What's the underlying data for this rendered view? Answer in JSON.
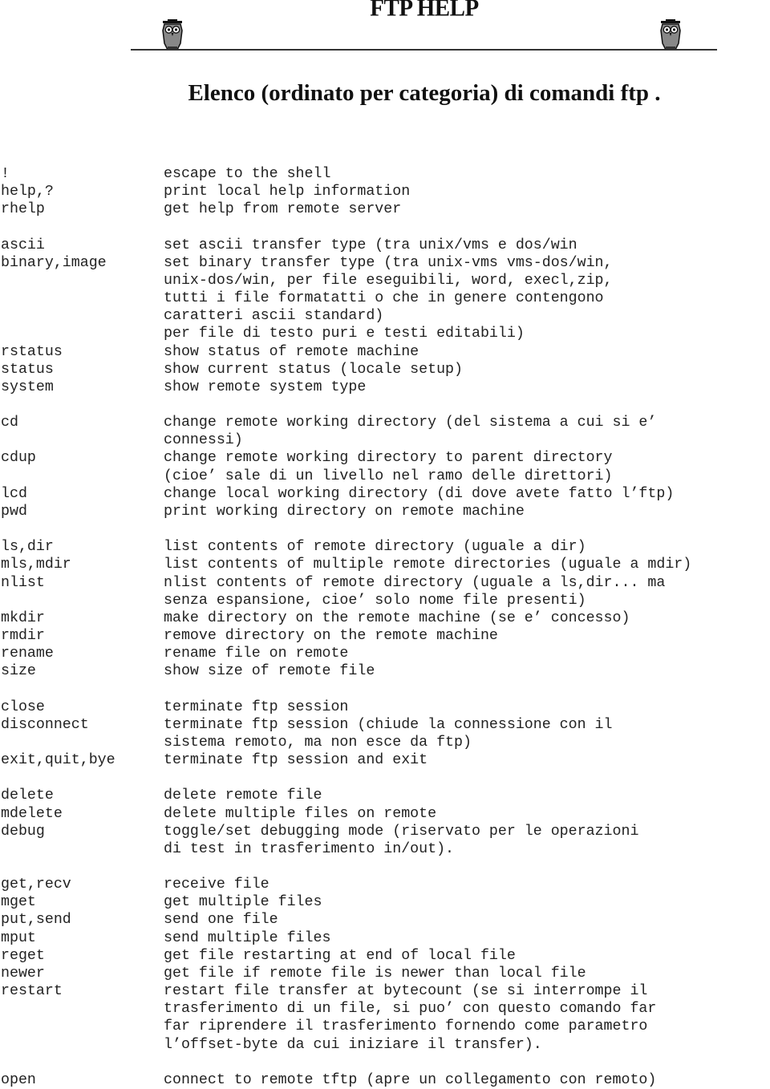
{
  "header": {
    "title": "FTP HELP",
    "subtitle": "Elenco (ordinato per categoria) di comandi ftp ."
  },
  "icons": [
    "owl-icon",
    "owl-icon"
  ],
  "groups": [
    {
      "rows": [
        {
          "cmd": "!",
          "desc": [
            "escape to the shell"
          ]
        },
        {
          "cmd": "help,?",
          "desc": [
            "print local help information"
          ]
        },
        {
          "cmd": "rhelp",
          "desc": [
            "get help from remote server"
          ]
        }
      ]
    },
    {
      "rows": [
        {
          "cmd": "ascii",
          "desc": [
            "set ascii transfer type (tra unix/vms e dos/win"
          ]
        },
        {
          "cmd": "binary,image",
          "desc": [
            "set binary transfer type (tra unix-vms vms-dos/win,",
            "unix-dos/win, per file eseguibili, word, execl,zip,",
            "tutti i file formatatti o che in genere contengono",
            "caratteri ascii standard)",
            "per file di testo puri e testi editabili)"
          ]
        },
        {
          "cmd": "rstatus",
          "desc": [
            "show status of remote machine"
          ]
        },
        {
          "cmd": "status",
          "desc": [
            "show current status (locale setup)"
          ]
        },
        {
          "cmd": "system",
          "desc": [
            "show remote system type"
          ]
        }
      ]
    },
    {
      "rows": [
        {
          "cmd": "cd",
          "desc": [
            "change remote working directory (del sistema a cui si e’",
            "connessi)"
          ]
        },
        {
          "cmd": "cdup",
          "desc": [
            "change remote working directory to parent directory",
            "(cioe’ sale di un livello nel ramo delle direttori)"
          ]
        },
        {
          "cmd": "lcd",
          "desc": [
            "change local working directory (di dove avete fatto l’ftp)"
          ]
        },
        {
          "cmd": "pwd",
          "desc": [
            "print working directory on remote machine"
          ]
        }
      ]
    },
    {
      "rows": [
        {
          "cmd": "ls,dir",
          "desc": [
            "list contents of remote directory (uguale a dir)"
          ]
        },
        {
          "cmd": "mls,mdir",
          "desc": [
            "list contents of multiple remote directories (uguale a mdir)"
          ]
        },
        {
          "cmd": "nlist",
          "desc": [
            "nlist contents of remote directory (uguale a ls,dir... ma",
            "senza espansione, cioe’ solo nome file presenti)"
          ]
        },
        {
          "cmd": "mkdir",
          "desc": [
            "make directory on the remote machine (se e’ concesso)"
          ]
        },
        {
          "cmd": "rmdir",
          "desc": [
            "remove directory on the remote machine"
          ]
        },
        {
          "cmd": "rename",
          "desc": [
            "rename file on remote"
          ]
        },
        {
          "cmd": "size",
          "desc": [
            "show size of remote file"
          ]
        }
      ]
    },
    {
      "rows": [
        {
          "cmd": "close",
          "desc": [
            "terminate ftp session"
          ]
        },
        {
          "cmd": "disconnect",
          "desc": [
            "terminate ftp session (chiude la connessione con il",
            "sistema remoto, ma non esce da ftp)"
          ]
        },
        {
          "cmd": "exit,quit,bye",
          "desc": [
            "terminate ftp session and exit"
          ]
        }
      ]
    },
    {
      "rows": [
        {
          "cmd": "delete",
          "desc": [
            "delete remote file"
          ]
        },
        {
          "cmd": "mdelete",
          "desc": [
            "delete multiple files on remote"
          ]
        },
        {
          "cmd": "debug",
          "desc": [
            "toggle/set debugging mode (riservato per le operazioni",
            "di test in trasferimento in/out)."
          ]
        }
      ]
    },
    {
      "rows": [
        {
          "cmd": "get,recv",
          "desc": [
            "receive file"
          ]
        },
        {
          "cmd": "mget",
          "desc": [
            "get multiple files"
          ]
        },
        {
          "cmd": "put,send",
          "desc": [
            "send one file"
          ]
        },
        {
          "cmd": "mput",
          "desc": [
            "send multiple files"
          ]
        },
        {
          "cmd": "reget",
          "desc": [
            "get file restarting at end of local file"
          ]
        },
        {
          "cmd": "newer",
          "desc": [
            "get file if remote file is newer than local file"
          ]
        },
        {
          "cmd": "restart",
          "desc": [
            "restart file transfer at bytecount (se si interrompe il",
            "trasferimento di un file, si puo’ con questo comando far",
            "far riprendere il trasferimento fornendo come parametro",
            "l’offset-byte da cui iniziare il transfer)."
          ]
        }
      ]
    },
    {
      "rows": [
        {
          "cmd": "open",
          "desc": [
            "connect to remote tftp (apre un collegamento con remoto)"
          ]
        }
      ]
    }
  ]
}
